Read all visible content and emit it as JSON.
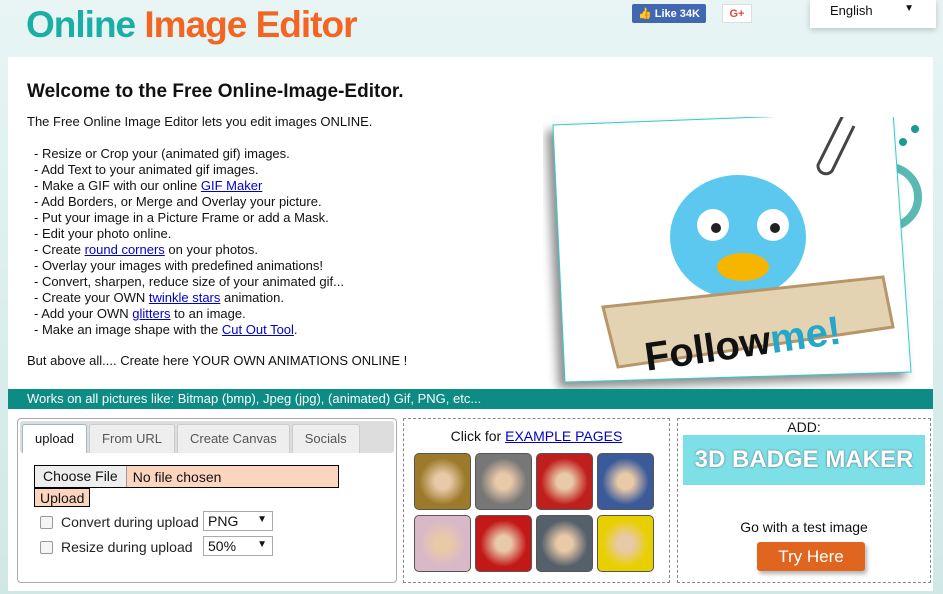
{
  "header": {
    "logo_part1": "Online",
    "logo_part2": "Image Editor",
    "like_label": "Like 34K",
    "gplus_label": "G+",
    "language": "English"
  },
  "main": {
    "title": "Welcome to the Free Online-Image-Editor.",
    "intro": "The Free Online Image Editor lets you edit images ONLINE.",
    "features": [
      [
        {
          "t": "- Resize or Crop your (animated gif) images."
        }
      ],
      [
        {
          "t": "- Add Text to your animated gif images."
        }
      ],
      [
        {
          "t": "- Make a GIF with our online "
        },
        {
          "t": "GIF Maker",
          "link": true
        }
      ],
      [
        {
          "t": "- Add Borders, or Merge and Overlay your picture."
        }
      ],
      [
        {
          "t": "- Put your image in a Picture Frame or add a Mask."
        }
      ],
      [
        {
          "t": "- Edit your photo online."
        }
      ],
      [
        {
          "t": "- Create "
        },
        {
          "t": "round corners",
          "link": true
        },
        {
          "t": " on your photos."
        }
      ],
      [
        {
          "t": "- Overlay your images with predefined animations!"
        }
      ],
      [
        {
          "t": "- Convert, sharpen, reduce size of your animated gif..."
        }
      ],
      [
        {
          "t": "- Create your OWN "
        },
        {
          "t": "twinkle stars",
          "link": true
        },
        {
          "t": " animation."
        }
      ],
      [
        {
          "t": "- Add your OWN "
        },
        {
          "t": "glitters",
          "link": true
        },
        {
          "t": " to an image."
        }
      ],
      [
        {
          "t": "- Make an image shape with the "
        },
        {
          "t": "Cut Out Tool",
          "link": true
        },
        {
          "t": "."
        }
      ]
    ],
    "above_all": "But above all.... Create here YOUR OWN ANIMATIONS ONLINE !",
    "hero_text1": "Follow",
    "hero_text2": "me!"
  },
  "banner": "Works on all pictures like: Bitmap (bmp), Jpeg (jpg), (animated) Gif, PNG, etc...",
  "upload": {
    "tabs": [
      "upload",
      "From URL",
      "Create Canvas",
      "Socials"
    ],
    "choose_file": "Choose File",
    "file_status": "No file chosen",
    "upload_button": "Upload",
    "convert_label": "Convert during upload",
    "convert_value": "PNG",
    "resize_label": "Resize during upload",
    "resize_value": "50%"
  },
  "examples": {
    "prefix": "Click for ",
    "link": "EXAMPLE PAGES",
    "thumb_colors": [
      "#9c7a2a",
      "#777",
      "#c0201d",
      "#3a5a9a",
      "#d9b8c8",
      "#c21818",
      "#55606a",
      "#e8d000"
    ]
  },
  "ad": {
    "label": "ADD:",
    "badge": "3D BADGE MAKER",
    "go_text": "Go with a test image",
    "try_button": "Try Here"
  }
}
